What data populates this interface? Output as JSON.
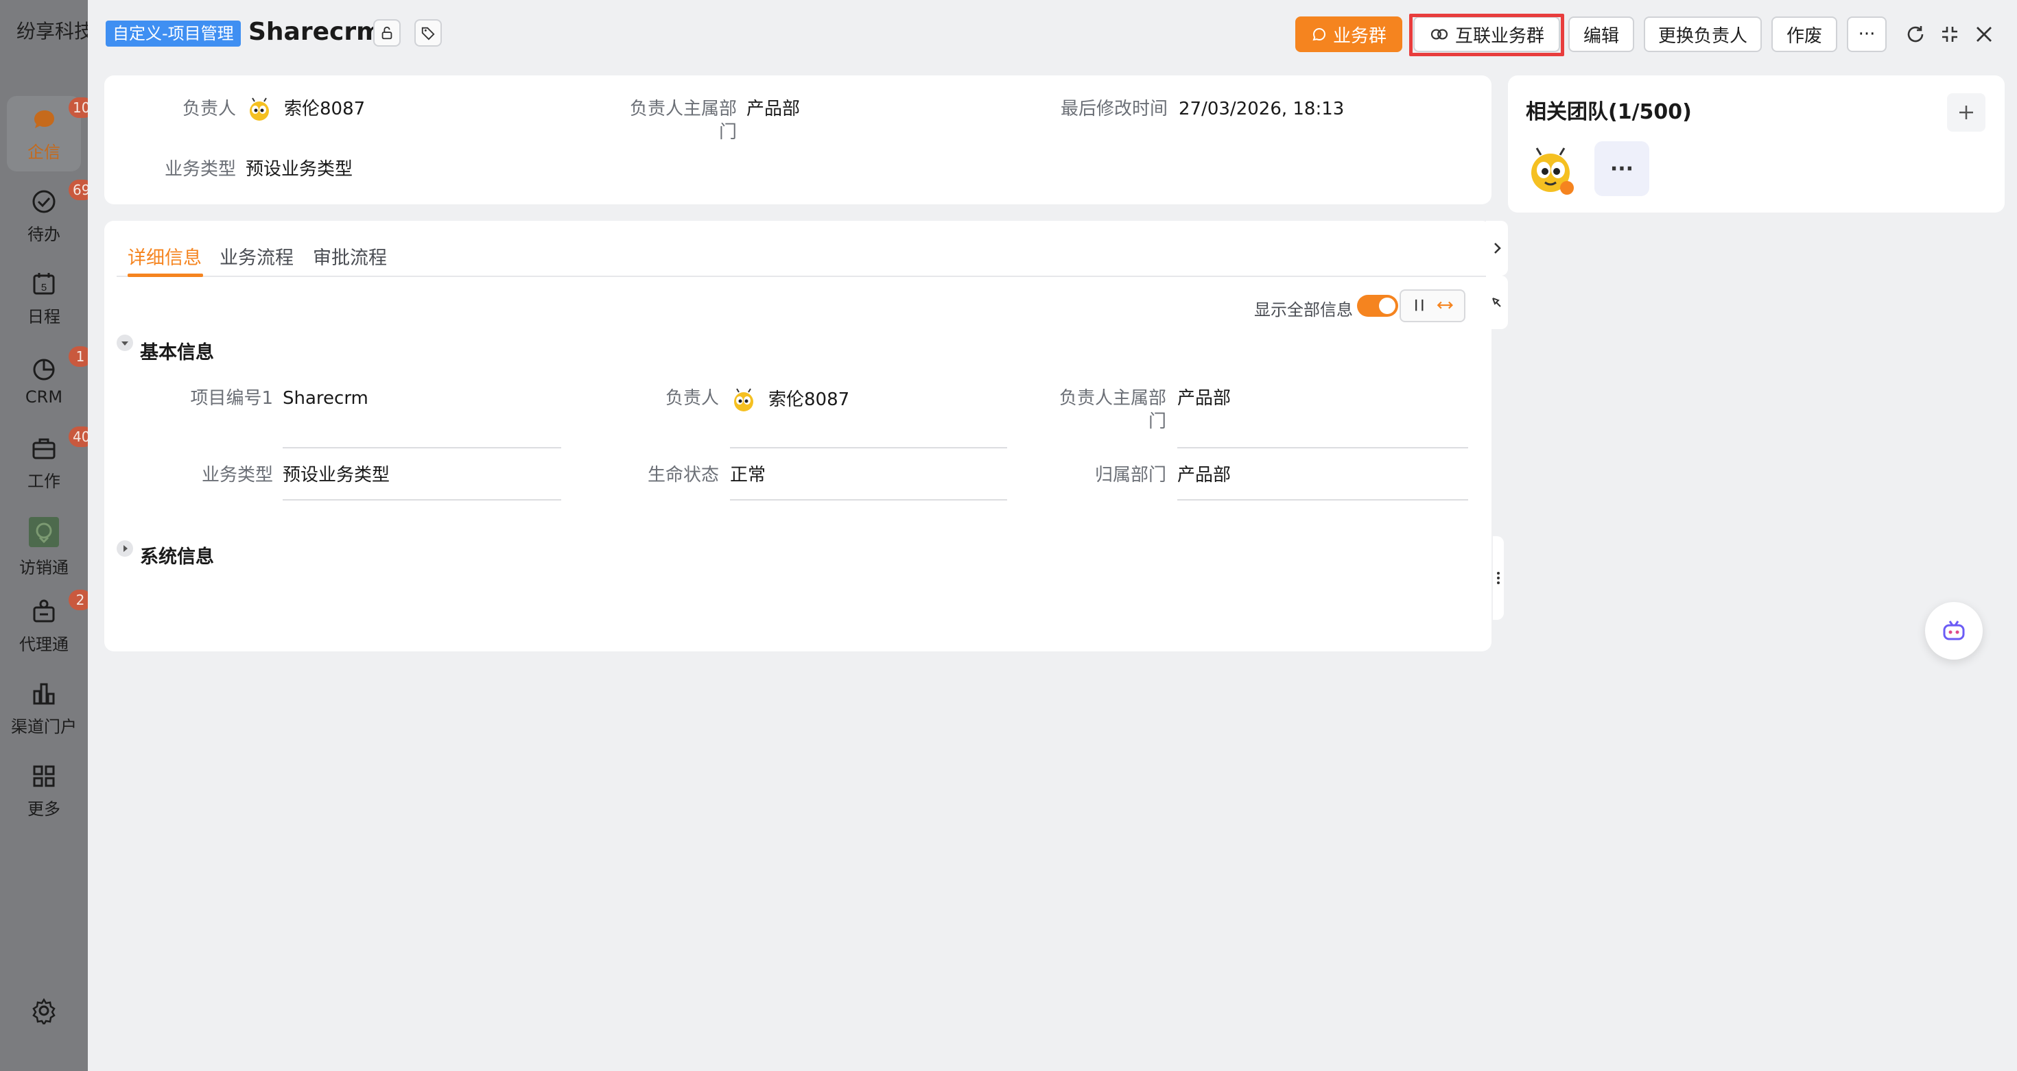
{
  "app": {
    "company": "纷享科技",
    "nav": [
      {
        "label": "企信",
        "badge": "10",
        "icon": "chat-icon"
      },
      {
        "label": "待办",
        "badge": "69",
        "icon": "todo-check-icon"
      },
      {
        "label": "日程",
        "badge": "",
        "icon": "calendar-icon",
        "calendar_day": "5"
      },
      {
        "label": "CRM",
        "badge": "1",
        "icon": "crm-chart-icon"
      },
      {
        "label": "工作",
        "badge": "40",
        "icon": "briefcase-icon"
      },
      {
        "label": "访销通",
        "badge": "",
        "icon": "visit-sales-icon"
      },
      {
        "label": "代理通",
        "badge": "2",
        "icon": "agent-icon"
      },
      {
        "label": "渠道门户",
        "badge": "",
        "icon": "channel-portal-icon"
      },
      {
        "label": "更多",
        "badge": "",
        "icon": "grid-more-icon"
      }
    ]
  },
  "header": {
    "object_tag": "自定义-项目管理",
    "title": "Sharecrm",
    "buttons": {
      "business_group": "业务群",
      "interconnect_group": "互联业务群",
      "edit": "编辑",
      "change_owner": "更换负责人",
      "void": "作废",
      "more": "···"
    }
  },
  "summary": {
    "owner_label": "负责人",
    "owner_value": "索伦8087",
    "owner_dept_label_1": "负责人主属部",
    "owner_dept_label_2": "门",
    "owner_dept_value": "产品部",
    "modified_label": "最后修改时间",
    "modified_value": "27/03/2026, 18:13",
    "biz_type_label": "业务类型",
    "biz_type_value": "预设业务类型"
  },
  "detail": {
    "tabs": [
      "详细信息",
      "业务流程",
      "审批流程"
    ],
    "show_all_label": "显示全部信息",
    "basic_section": "基本信息",
    "system_section": "系统信息",
    "fields": {
      "project_no_label": "项目编号1",
      "project_no_value": "Sharecrm",
      "owner_label": "负责人",
      "owner_value": "索伦8087",
      "owner_dept_label_1": "负责人主属部",
      "owner_dept_label_2": "门",
      "owner_dept_value": "产品部",
      "biz_type_label": "业务类型",
      "biz_type_value": "预设业务类型",
      "lifecycle_label": "生命状态",
      "lifecycle_value": "正常",
      "belong_dept_label": "归属部门",
      "belong_dept_value": "产品部"
    }
  },
  "team": {
    "title": "相关团队(1/500)",
    "more": "···"
  },
  "colors": {
    "accent": "#f5841f",
    "tag_blue": "#3f8ff2",
    "highlight_red": "#e83d3d"
  }
}
